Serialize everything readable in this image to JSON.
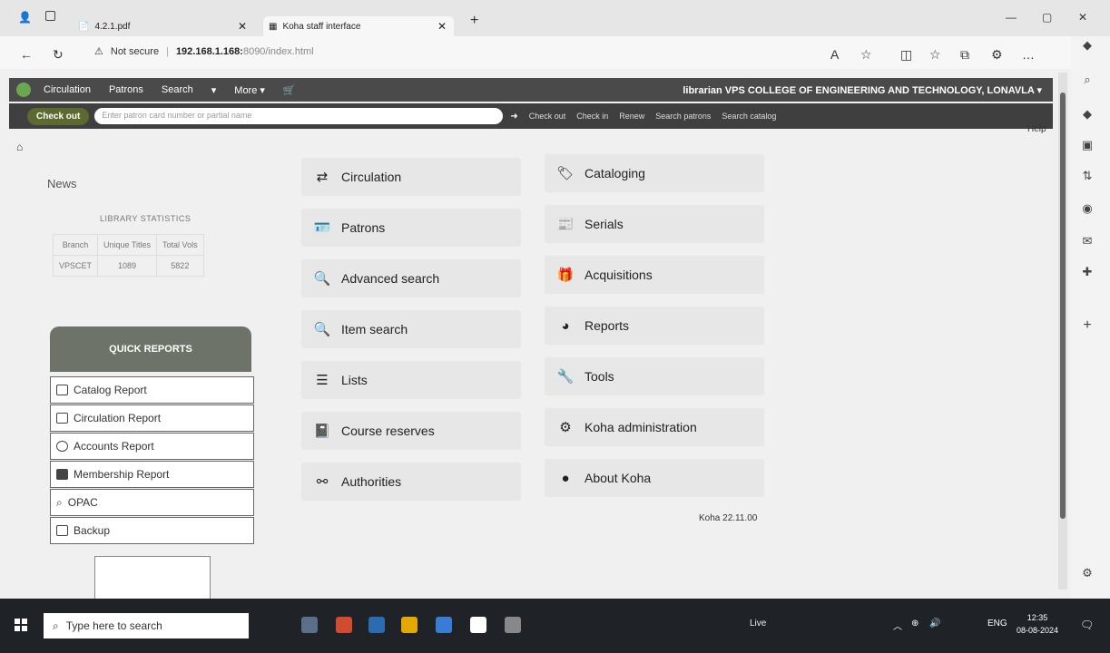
{
  "browser": {
    "tabs": [
      {
        "label": "4.2.1.pdf"
      },
      {
        "label": "Koha staff interface"
      }
    ],
    "new_tab": "+",
    "address": {
      "warning": "Not secure",
      "url_host": "192.168.1.168:",
      "url_rest": "8090/index.html"
    }
  },
  "koha": {
    "nav": {
      "items": [
        "Circulation",
        "Patrons",
        "Search",
        "More ▾"
      ],
      "library": "librarian VPS COLLEGE OF ENGINEERING AND TECHNOLOGY, LONAVLA ▾"
    },
    "checkout": {
      "button": "Check out",
      "placeholder": "Enter patron card number or partial name",
      "quick_links": [
        "Check out",
        "Check in",
        "Renew",
        "Search patrons",
        "Search catalog"
      ]
    },
    "help": "Help",
    "news": "News",
    "stats": {
      "title": "LIBRARY STATISTICS",
      "headers": [
        "Branch",
        "Unique Titles",
        "Total Vols"
      ],
      "row": [
        "VPSCET",
        "1089",
        "5822"
      ]
    },
    "quick_reports": {
      "title": "QUICK REPORTS",
      "items": [
        "Catalog Report",
        "Circulation Report",
        "Accounts Report",
        "Membership Report",
        "OPAC",
        "Backup"
      ]
    },
    "tiles_left": [
      "Circulation",
      "Patrons",
      "Advanced search",
      "Item search",
      "Lists",
      "Course reserves",
      "Authorities"
    ],
    "tiles_right": [
      "Cataloging",
      "Serials",
      "Acquisitions",
      "Reports",
      "Tools",
      "Koha administration",
      "About Koha"
    ],
    "version": "Koha 22.11.00"
  },
  "taskbar": {
    "search_placeholder": "Type here to search",
    "weather": "Live",
    "lang": "ENG",
    "time": "12:35",
    "date": "08-08-2024"
  }
}
